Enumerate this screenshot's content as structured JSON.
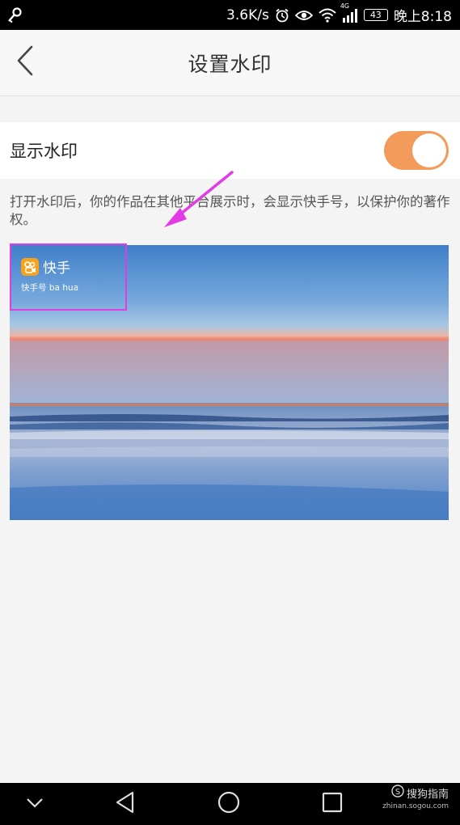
{
  "status_bar": {
    "speed": "3.6K/s",
    "network": "4G",
    "battery": "43",
    "time": "晚上8:18",
    "icons": [
      "key-icon",
      "alarm-icon",
      "eye-icon",
      "wifi-icon",
      "signal-icon"
    ]
  },
  "header": {
    "title": "设置水印",
    "back_icon": "chevron-left-icon"
  },
  "setting": {
    "label": "显示水印",
    "toggle_on": true,
    "accent_color": "#f29b5a"
  },
  "description": "打开水印后，你的作品在其他平台展示时，会显示快手号，以保护你的著作权。",
  "preview": {
    "watermark_name": "快手",
    "watermark_id": "快手号 ba   hua",
    "highlight_color": "#e23be6"
  },
  "nav_bar": {
    "icons": [
      "chevron-down-icon",
      "back-triangle-icon",
      "home-circle-icon",
      "recents-square-icon"
    ]
  },
  "site_watermark": {
    "name": "搜狗指南",
    "url": "zhinan.sogou.com"
  }
}
